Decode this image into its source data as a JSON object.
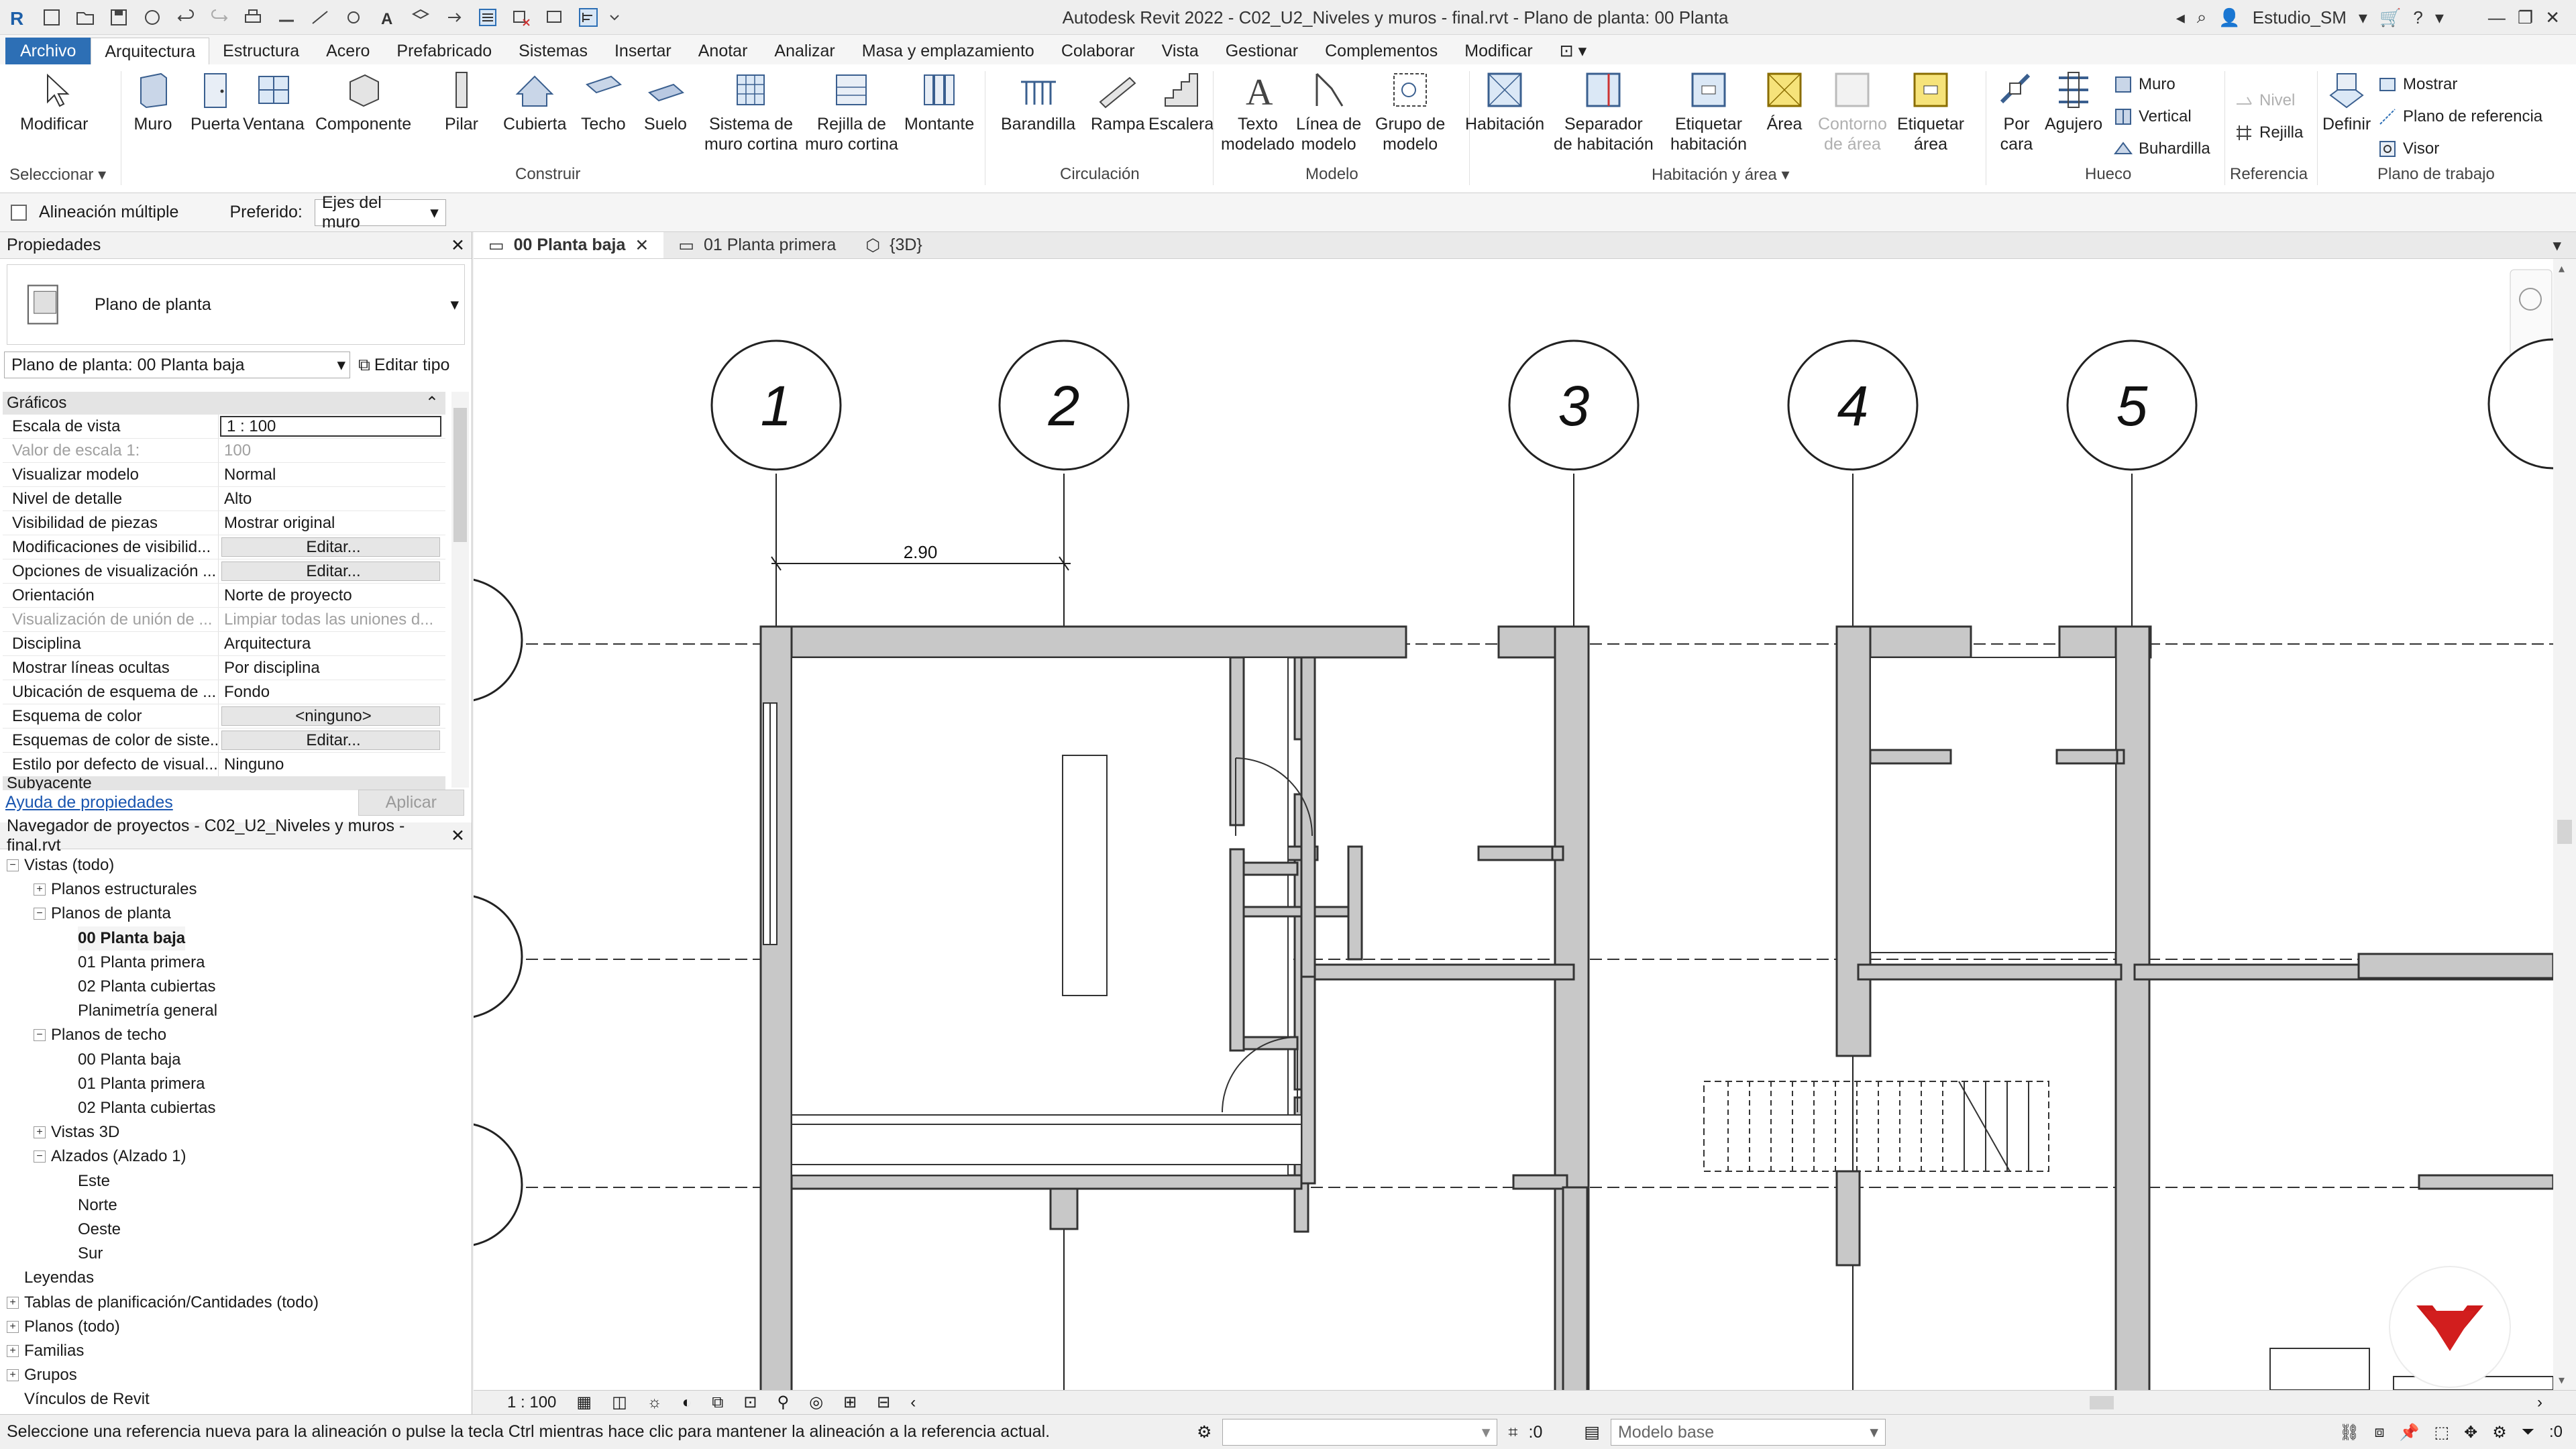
{
  "window": {
    "title": "Autodesk Revit 2022 - C02_U2_Niveles y muros - final.rvt - Plano de planta: 00 Planta baja",
    "user": "Estudio_SM"
  },
  "tabs": [
    "Archivo",
    "Arquitectura",
    "Estructura",
    "Acero",
    "Prefabricado",
    "Sistemas",
    "Insertar",
    "Anotar",
    "Analizar",
    "Masa y emplazamiento",
    "Colaborar",
    "Vista",
    "Gestionar",
    "Complementos",
    "Modificar"
  ],
  "ribbon": {
    "select_panel": {
      "modify": "Modificar",
      "label": "Seleccionar"
    },
    "build": {
      "label": "Construir",
      "wall": "Muro",
      "door": "Puerta",
      "window": "Ventana",
      "component": "Componente",
      "column": "Pilar",
      "roof": "Cubierta",
      "ceiling": "Techo",
      "floor": "Suelo",
      "curtain_system": "Sistema de\nmuro cortina",
      "curtain_grid": "Rejilla de\nmuro cortina",
      "mullion": "Montante"
    },
    "circulation": {
      "label": "Circulación",
      "railing": "Barandilla",
      "ramp": "Rampa",
      "stair": "Escalera"
    },
    "model": {
      "label": "Modelo",
      "model_text": "Texto\nmodelado",
      "model_line": "Línea de\nmodelo",
      "model_group": "Grupo de\nmodelo"
    },
    "room_area": {
      "label": "Habitación y área",
      "room": "Habitación",
      "room_separator": "Separador\nde habitación",
      "tag_room": "Etiquetar\nhabitación",
      "area": "Área",
      "area_boundary": "Contorno\nde área",
      "tag_area": "Etiquetar\nárea"
    },
    "opening": {
      "label": "Hueco",
      "by_face": "Por\ncara",
      "shaft": "Agujero",
      "wall": "Muro",
      "vertical": "Vertical",
      "dormer": "Buhardilla"
    },
    "datum": {
      "label": "Referencia",
      "level": "Nivel",
      "grid": "Rejilla"
    },
    "work_plane": {
      "label": "Plano de trabajo",
      "set": "Definir",
      "show": "Mostrar",
      "ref_plane": "Plano de referencia",
      "viewer": "Visor"
    }
  },
  "options_bar": {
    "multiple_alignment": "Alineación múltiple",
    "prefer_label": "Preferido:",
    "prefer_value": "Ejes del muro"
  },
  "properties": {
    "title": "Propiedades",
    "type_name": "Plano de planta",
    "instance": "Plano de planta: 00 Planta baja",
    "edit_type": "Editar tipo",
    "category": "Gráficos",
    "rows": [
      {
        "name": "Escala de vista",
        "value": "1 : 100"
      },
      {
        "name": "Valor de escala    1:",
        "value": "100"
      },
      {
        "name": "Visualizar modelo",
        "value": "Normal"
      },
      {
        "name": "Nivel de detalle",
        "value": "Alto"
      },
      {
        "name": "Visibilidad de piezas",
        "value": "Mostrar original"
      },
      {
        "name": "Modificaciones de visibilid...",
        "value": "Editar..."
      },
      {
        "name": "Opciones de visualización ...",
        "value": "Editar..."
      },
      {
        "name": "Orientación",
        "value": "Norte de proyecto"
      },
      {
        "name": "Visualización de unión de ...",
        "value": "Limpiar todas las uniones d..."
      },
      {
        "name": "Disciplina",
        "value": "Arquitectura"
      },
      {
        "name": "Mostrar líneas ocultas",
        "value": "Por disciplina"
      },
      {
        "name": "Ubicación de esquema de ...",
        "value": "Fondo"
      },
      {
        "name": "Esquema de color",
        "value": "<ninguno>"
      },
      {
        "name": "Esquemas de color de siste...",
        "value": "Editar..."
      },
      {
        "name": "Estilo por defecto de visual...",
        "value": "Ninguno"
      }
    ],
    "next_category": "Subyacente",
    "help_link": "Ayuda de propiedades",
    "apply": "Aplicar"
  },
  "project_browser": {
    "title": "Navegador de proyectos - C02_U2_Niveles y muros - final.rvt",
    "items": [
      {
        "label": "Vistas (todo)",
        "level": 0,
        "toggle": "−"
      },
      {
        "label": "Planos estructurales",
        "level": 1,
        "toggle": "+"
      },
      {
        "label": "Planos de planta",
        "level": 1,
        "toggle": "−"
      },
      {
        "label": "00 Planta baja",
        "level": 2,
        "toggle": ""
      },
      {
        "label": "01 Planta primera",
        "level": 2,
        "toggle": ""
      },
      {
        "label": "02 Planta cubiertas",
        "level": 2,
        "toggle": ""
      },
      {
        "label": "Planimetría general",
        "level": 2,
        "toggle": ""
      },
      {
        "label": "Planos de techo",
        "level": 1,
        "toggle": "−"
      },
      {
        "label": "00 Planta baja",
        "level": 2,
        "toggle": ""
      },
      {
        "label": "01 Planta primera",
        "level": 2,
        "toggle": ""
      },
      {
        "label": "02 Planta cubiertas",
        "level": 2,
        "toggle": ""
      },
      {
        "label": "Vistas 3D",
        "level": 1,
        "toggle": "+"
      },
      {
        "label": "Alzados (Alzado 1)",
        "level": 1,
        "toggle": "−"
      },
      {
        "label": "Este",
        "level": 2,
        "toggle": ""
      },
      {
        "label": "Norte",
        "level": 2,
        "toggle": ""
      },
      {
        "label": "Oeste",
        "level": 2,
        "toggle": ""
      },
      {
        "label": "Sur",
        "level": 2,
        "toggle": ""
      },
      {
        "label": "Leyendas",
        "level": 0,
        "toggle": ""
      },
      {
        "label": "Tablas de planificación/Cantidades (todo)",
        "level": 0,
        "toggle": "+"
      },
      {
        "label": "Planos (todo)",
        "level": 0,
        "toggle": "+"
      },
      {
        "label": "Familias",
        "level": 0,
        "toggle": "+"
      },
      {
        "label": "Grupos",
        "level": 0,
        "toggle": "+"
      },
      {
        "label": "Vínculos de Revit",
        "level": 0,
        "toggle": ""
      }
    ]
  },
  "view_tabs": [
    "00 Planta baja",
    "01 Planta primera",
    "{3D}"
  ],
  "drawing": {
    "grid_labels": [
      "1",
      "2",
      "3",
      "4",
      "5"
    ],
    "dimension": "2.90"
  },
  "view_control": {
    "scale": "1 : 100"
  },
  "status": {
    "message": "Seleccione una referencia nueva para la alineación o pulse la tecla Ctrl mientras hace clic para mantener la alineación a la referencia actual.",
    "count": ":0",
    "model": "Modelo base",
    "filter_count": ":0"
  }
}
